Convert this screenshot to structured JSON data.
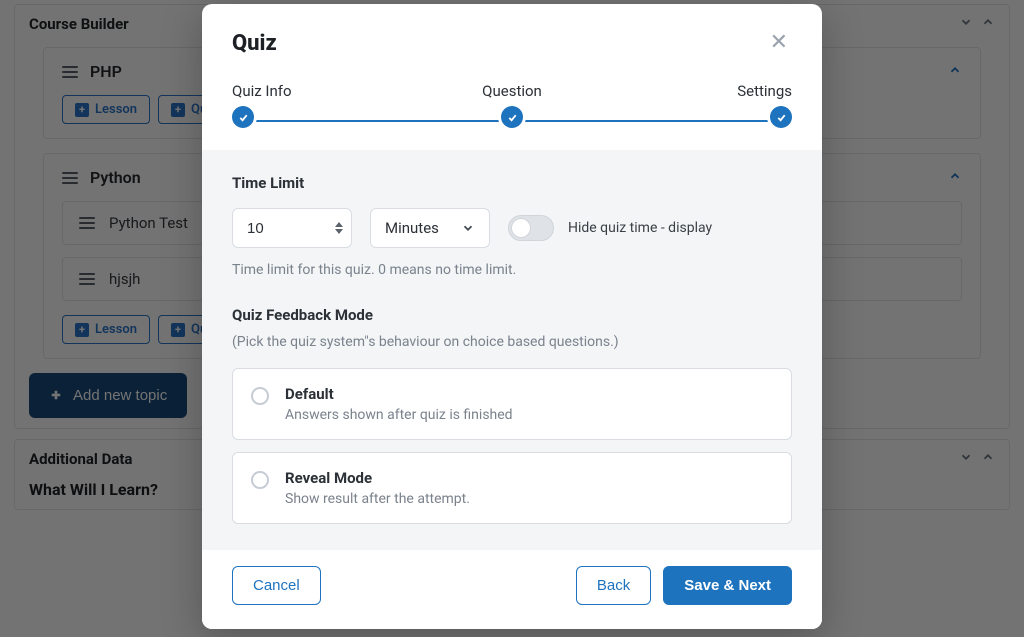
{
  "bg": {
    "course_builder": "Course Builder",
    "topics": [
      {
        "title": "PHP",
        "items": [],
        "btn_lesson": "Lesson",
        "btn_quiz": "Quiz"
      },
      {
        "title": "Python",
        "items": [
          "Python Test",
          "hjsjh"
        ],
        "btn_lesson": "Lesson",
        "btn_quiz": "Quiz"
      }
    ],
    "add_topic": "Add new topic",
    "additional_data": "Additional Data",
    "what_learn": "What Will I Learn?"
  },
  "modal": {
    "title": "Quiz",
    "steps": [
      "Quiz Info",
      "Question",
      "Settings"
    ],
    "time_limit": {
      "label": "Time Limit",
      "value": "10",
      "unit": "Minutes",
      "toggle_label": "Hide quiz time - display",
      "help": "Time limit for this quiz. 0 means no time limit."
    },
    "feedback": {
      "label": "Quiz Feedback Mode",
      "sub": "(Pick the quiz system\"s behaviour on choice based questions.)",
      "options": [
        {
          "label": "Default",
          "desc": "Answers shown after quiz is finished"
        },
        {
          "label": "Reveal Mode",
          "desc": "Show result after the attempt."
        }
      ]
    },
    "buttons": {
      "cancel": "Cancel",
      "back": "Back",
      "next": "Save & Next"
    }
  }
}
